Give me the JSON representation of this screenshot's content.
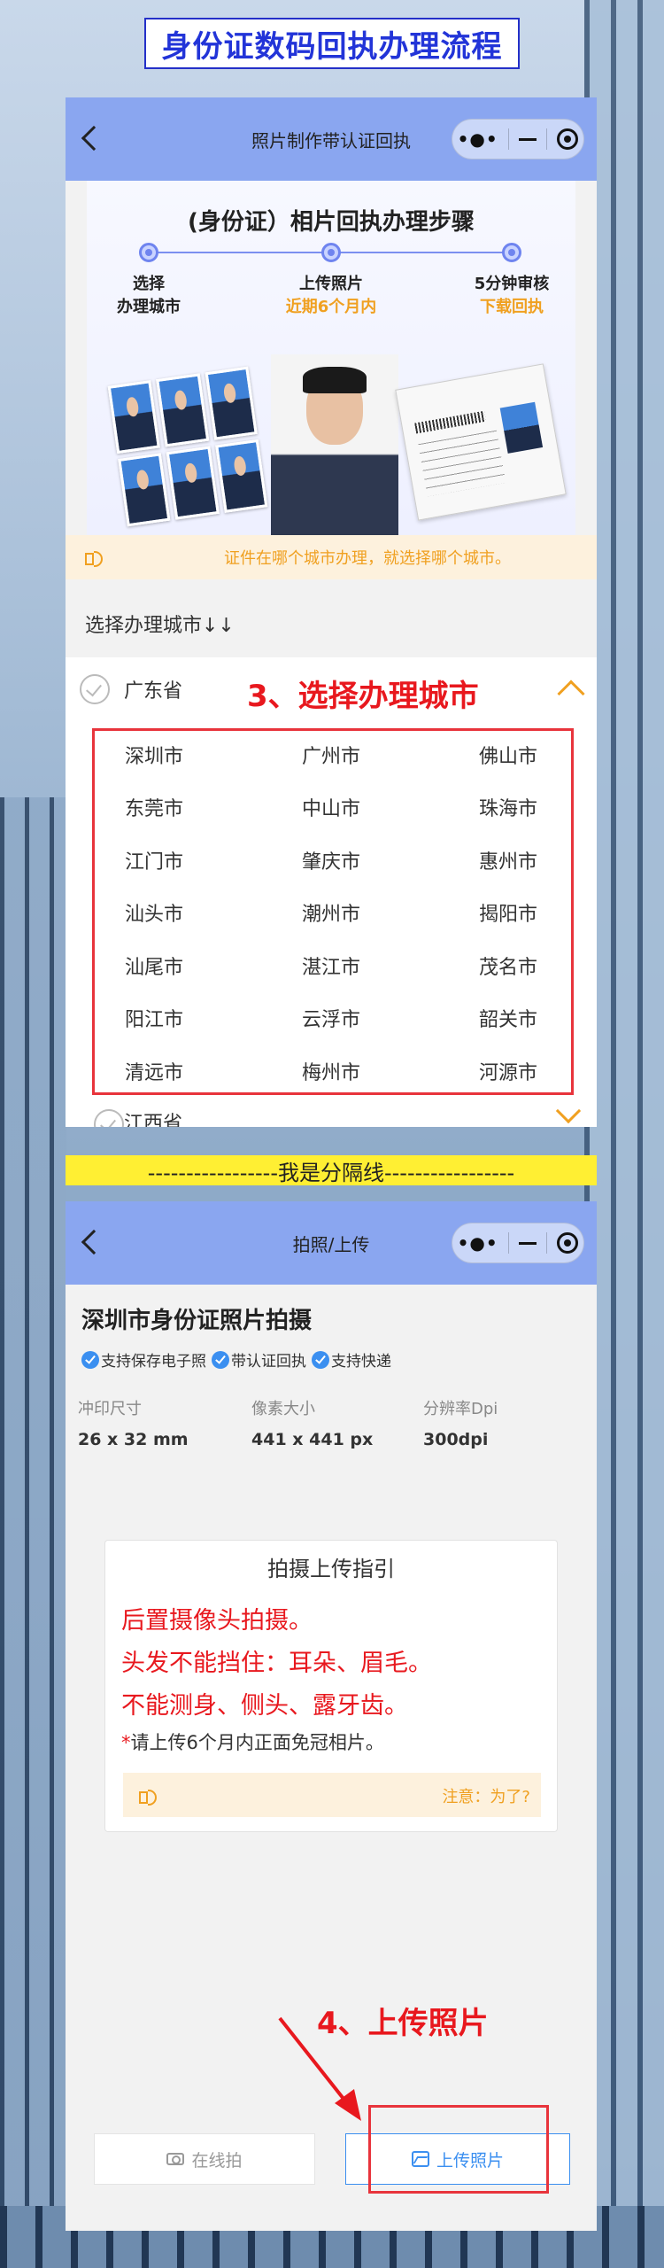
{
  "banner": {
    "title": "身份证数码回执办理流程"
  },
  "page1": {
    "nav_title": "照片制作带认证回执",
    "hero": {
      "title": "(身份证）相片回执办理步骤",
      "steps": [
        {
          "line1": "选择",
          "line2": "办理城市"
        },
        {
          "line1": "上传照片",
          "line2": "近期6个月内"
        },
        {
          "line1": "5分钟审核",
          "line2": "下载回执"
        }
      ]
    },
    "notice": "证件在哪个城市办理，就选择哪个城市。",
    "section_label": "选择办理城市↓↓",
    "province": "广东省",
    "annotation": "3、选择办理城市",
    "cities": [
      "深圳市",
      "广州市",
      "佛山市",
      "东莞市",
      "中山市",
      "珠海市",
      "江门市",
      "肇庆市",
      "惠州市",
      "汕头市",
      "潮州市",
      "揭阳市",
      "汕尾市",
      "湛江市",
      "茂名市",
      "阳江市",
      "云浮市",
      "韶关市",
      "清远市",
      "梅州市",
      "河源市"
    ],
    "next_province": "江西省"
  },
  "divider": "-----------------我是分隔线-----------------",
  "page2": {
    "nav_title": "拍照/上传",
    "title": "深圳市身份证照片拍摄",
    "tags": [
      "支持保存电子照",
      "带认证回执",
      "支持快递"
    ],
    "specs": [
      {
        "label": "冲印尺寸",
        "value": "26 x 32 mm"
      },
      {
        "label": "像素大小",
        "value": "441 x 441 px"
      },
      {
        "label": "分辨率Dpi",
        "value": "300dpi"
      }
    ],
    "guide": {
      "title": "拍摄上传指引",
      "lines": [
        "后置摄像头拍摄。",
        "头发不能挡住：耳朵、眉毛。",
        "不能测身、侧头、露牙齿。"
      ],
      "note_star": "*",
      "note": "请上传6个月内正面免冠相片。",
      "notice": "注意：为了?"
    },
    "annotation": "4、上传照片",
    "btn_shoot": "在线拍",
    "btn_upload": "上传照片"
  },
  "colors": {
    "accent": "#f0a020",
    "nav": "#8aa6f0",
    "annotation_red": "#e8181e",
    "link_blue": "#3b8ff0",
    "banner_blue": "#2234d8"
  }
}
